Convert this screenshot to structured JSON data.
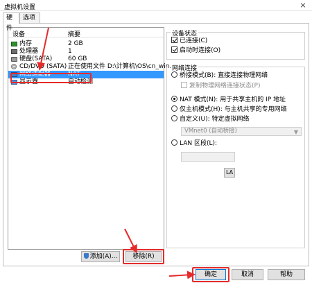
{
  "window": {
    "title": "虚拟机设置",
    "close_glyph": "×"
  },
  "tabs": [
    {
      "label": "硬件"
    },
    {
      "label": "选项"
    }
  ],
  "device_list": {
    "col_device": "设备",
    "col_summary": "摘要",
    "rows": [
      {
        "name": "内存",
        "summary": "2 GB",
        "icon": "memory-icon"
      },
      {
        "name": "处理器",
        "summary": "1",
        "icon": "cpu-icon"
      },
      {
        "name": "硬盘(SATA)",
        "summary": "60 GB",
        "icon": "disk-icon"
      },
      {
        "name": "CD/DVD (SATA)",
        "summary": "正在使用文件 D:\\计算机\\OS\\cn_win...",
        "icon": "cd-icon"
      },
      {
        "name": "网络适配器",
        "summary": "NAT",
        "icon": "network-icon"
      },
      {
        "name": "显示器",
        "summary": "自动检测",
        "icon": "display-icon"
      }
    ],
    "selected_index": 4
  },
  "device_buttons": {
    "add": "添加(A)...",
    "remove": "移除(R)"
  },
  "device_status": {
    "title": "设备状态",
    "connected": "已连接(C)",
    "connect_on_power": "启动时连接(O)"
  },
  "network": {
    "title": "网络连接",
    "bridged": "桥接模式(B): 直接连接物理网络",
    "replicate": "复制物理网络连接状态(P)",
    "nat": "NAT 模式(N): 用于共享主机的 IP 地址",
    "host_only": "仅主机模式(H): 与主机共享的专用网络",
    "custom": "自定义(U): 特定虚拟网络",
    "custom_select": "VMnet0 (自动桥接)",
    "lan": "LAN 区段(L):",
    "lan_button": "LA"
  },
  "footer": {
    "ok": "确定",
    "cancel": "取消",
    "help": "帮助"
  },
  "colors": {
    "selection": "#3399ff",
    "annotation": "#e52b2b"
  }
}
